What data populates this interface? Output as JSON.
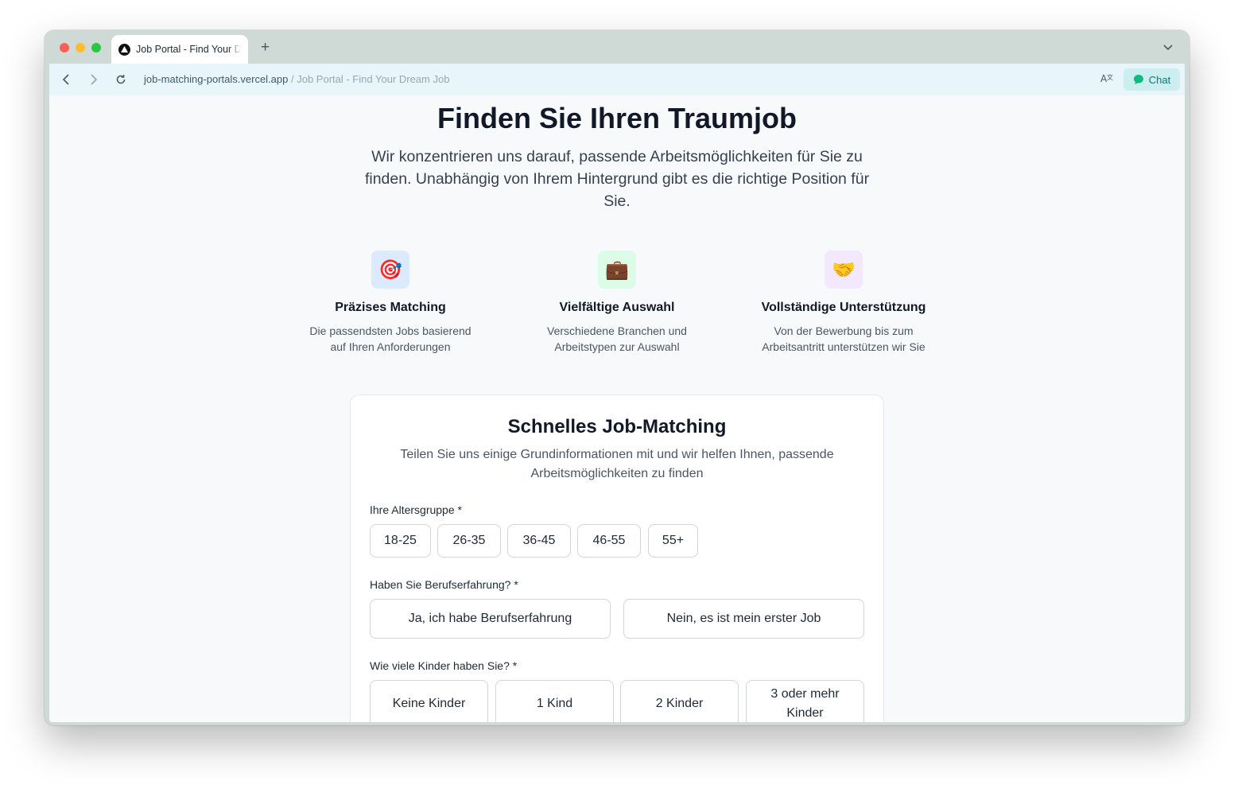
{
  "browser": {
    "tab_title": "Job Portal - Find Your Dream Job",
    "url_host": "job-matching-portals.vercel.app",
    "url_separator": " / ",
    "url_page_title": "Job Portal - Find Your Dream Job",
    "chat_label": "Chat"
  },
  "hero": {
    "title": "Finden Sie Ihren Traumjob",
    "subtitle": "Wir konzentrieren uns darauf, passende Arbeitsmöglichkeiten für Sie zu finden. Unabhängig von Ihrem Hintergrund gibt es die richtige Position für Sie."
  },
  "features": [
    {
      "icon": "🎯",
      "icon_name": "target-icon",
      "bg": "#dbeafe",
      "title": "Präzises Matching",
      "desc": "Die passendsten Jobs basierend auf Ihren Anforderungen"
    },
    {
      "icon": "💼",
      "icon_name": "briefcase-icon",
      "bg": "#dcfce7",
      "title": "Vielfältige Auswahl",
      "desc": "Verschiedene Branchen und Arbeitstypen zur Auswahl"
    },
    {
      "icon": "🤝",
      "icon_name": "handshake-icon",
      "bg": "#f3e8ff",
      "title": "Vollständige Unterstützung",
      "desc": "Von der Bewerbung bis zum Arbeitsantritt unterstützen wir Sie"
    }
  ],
  "form": {
    "title": "Schnelles Job-Matching",
    "subtitle": "Teilen Sie uns einige Grundinformationen mit und wir helfen Ihnen, passende Arbeitsmöglichkeiten zu finden",
    "age": {
      "label": "Ihre Altersgruppe *",
      "options": [
        "18-25",
        "26-35",
        "36-45",
        "46-55",
        "55+"
      ]
    },
    "experience": {
      "label": "Haben Sie Berufserfahrung? *",
      "options": [
        "Ja, ich habe Berufserfahrung",
        "Nein, es ist mein erster Job"
      ]
    },
    "children": {
      "label": "Wie viele Kinder haben Sie? *",
      "options": [
        "Keine Kinder",
        "1 Kind",
        "2 Kinder",
        "3 oder mehr Kinder"
      ]
    }
  }
}
